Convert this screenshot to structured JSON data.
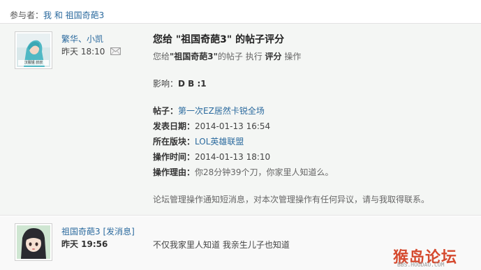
{
  "participants": {
    "label": "参与者：",
    "names": "我 和 祖国奇葩3"
  },
  "message1": {
    "sender": "繁华、小凯",
    "time": "昨天 18:10",
    "title": "您给 \"祖国奇葩3\" 的帖子评分",
    "summary_prefix": "您给",
    "summary_target": "\"祖国奇葩3\"",
    "summary_mid": "的帖子 执行",
    "summary_action": "评分",
    "summary_suffix": "操作",
    "effect_label": "影响：",
    "effect_value": "D B :1",
    "post_label": "帖子：",
    "post_value": "第一次EZ居然卡锐全场",
    "publish_label": "发表日期：",
    "publish_value": "2014-01-13 16:54",
    "board_label": "所在版块：",
    "board_value": "LOL英雄联盟",
    "optime_label": "操作时间：",
    "optime_value": "2014-01-13 18:10",
    "reason_label": "操作理由：",
    "reason_value": "你28分钟39个刀，你家里人知道么。",
    "notice": "论坛管理操作通知短消息，对本次管理操作有任何异议，请与我取得联系。",
    "avatar_caption": "汉服姐 叔叔"
  },
  "message2": {
    "sender": "祖国奇葩3",
    "action": "[发消息]",
    "time": "昨天 19:56",
    "content": "不仅我家里人知道 我亲生儿子也知道"
  },
  "watermark": {
    "title": "猴岛论坛",
    "sub": "BBS.HOUDAO.COM"
  },
  "icons": {
    "mail": "envelope-icon"
  },
  "colors": {
    "link": "#2b6a9e",
    "background_msg1": "#f4f6f4",
    "watermark": "#d54a2f"
  }
}
